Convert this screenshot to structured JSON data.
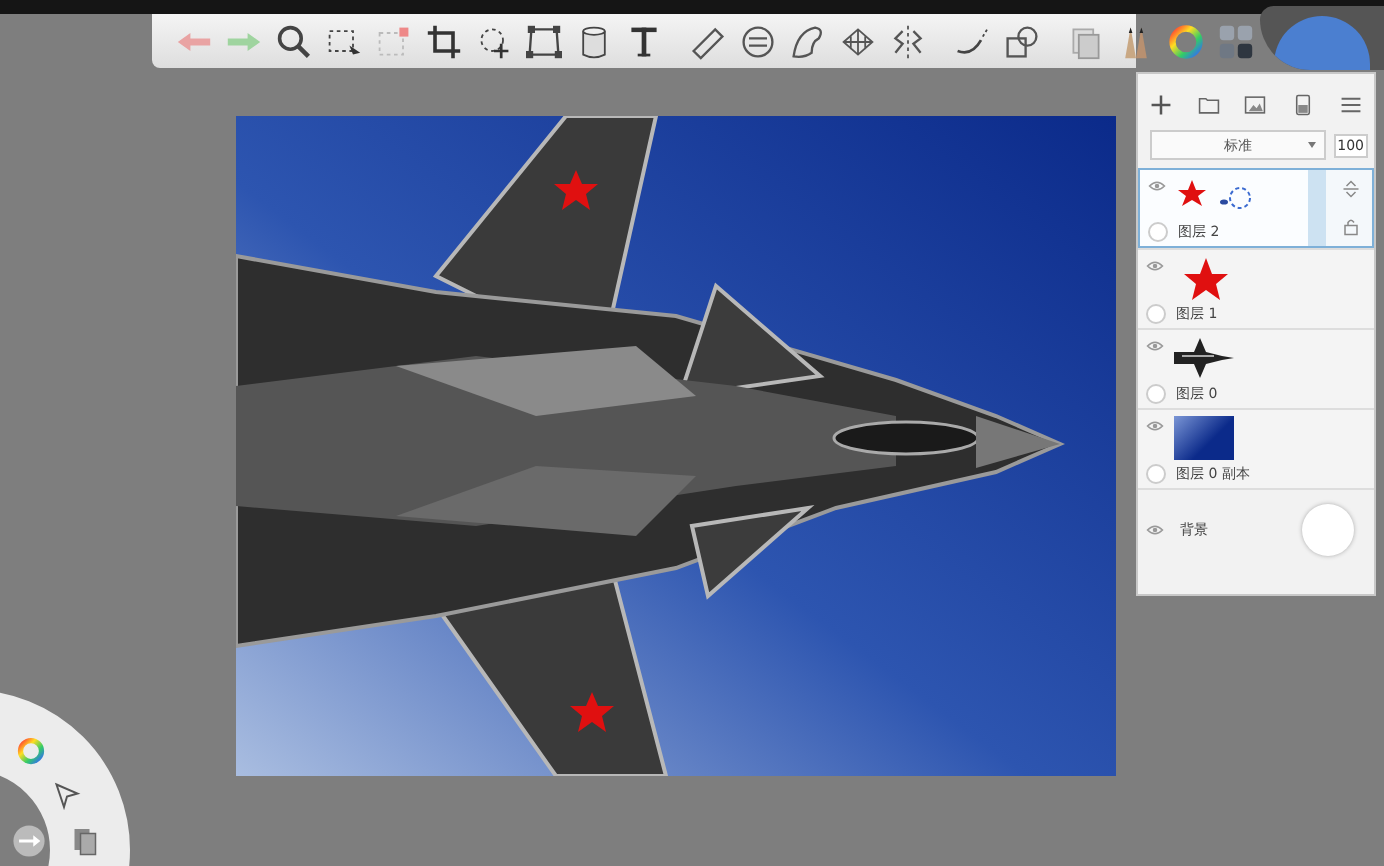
{
  "layers_panel": {
    "blend_mode": "标准",
    "opacity": "100",
    "layers": [
      {
        "name": "图层 2",
        "kind": "star-small",
        "selected": true
      },
      {
        "name": "图层 1",
        "kind": "star",
        "selected": false
      },
      {
        "name": "图层 0",
        "kind": "jet",
        "selected": false
      },
      {
        "name": "图层 0 副本",
        "kind": "gradient",
        "selected": false
      }
    ],
    "background": {
      "name": "背景"
    }
  }
}
